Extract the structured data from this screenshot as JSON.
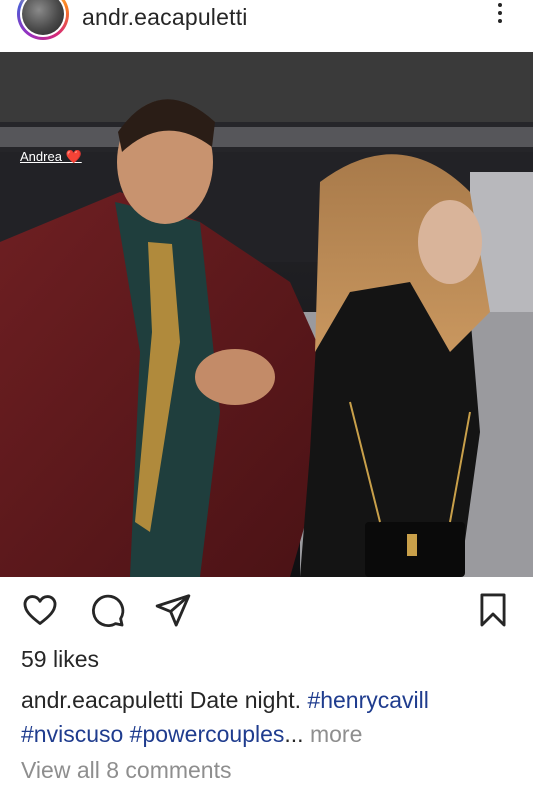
{
  "post": {
    "username": "andr.eacapuletti",
    "photo_tag": "Andrea ❤️",
    "likes": "59 likes",
    "caption": {
      "username": "andr.eacapuletti",
      "text": " Date night. ",
      "hashtags": [
        "#henrycavill",
        "#nviscuso",
        "#powercouples"
      ],
      "ellipsis": "...",
      "more": "more"
    },
    "comments_link": "View all 8 comments"
  },
  "icons": [
    "more-vertical-icon",
    "heart-icon",
    "comment-icon",
    "share-icon",
    "bookmark-icon"
  ],
  "colors": {
    "text": "#262626",
    "hashtag": "#1f3c8e",
    "muted": "#8e8e8e",
    "background": "#ffffff"
  }
}
